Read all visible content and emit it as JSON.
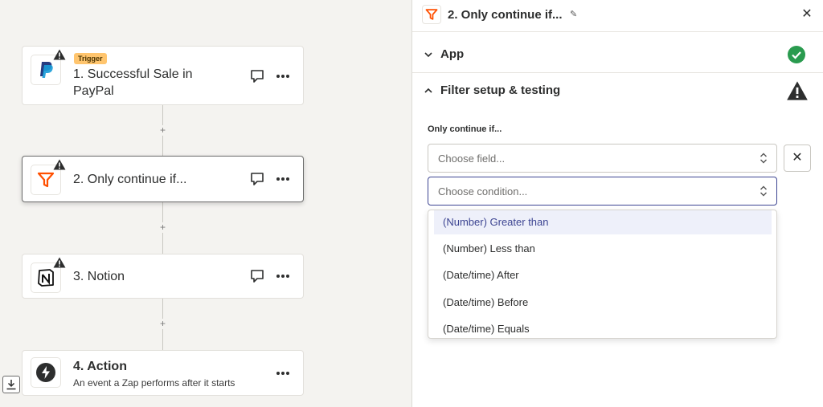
{
  "canvas": {
    "steps": [
      {
        "badge": "Trigger",
        "title_line1": "1. Successful Sale in",
        "title_line2": "PayPal"
      },
      {
        "title": "2. Only continue if..."
      },
      {
        "title": "3. Notion"
      },
      {
        "title": "4. Action",
        "subtitle": "An event a Zap performs after it starts"
      }
    ],
    "plus_label": "+",
    "icons": {
      "paypal": "paypal-icon",
      "filter": "filter-icon",
      "notion": "notion-icon",
      "action": "lightning-icon",
      "warning": "warning-icon",
      "comment": "comment-icon",
      "more": "more-icon",
      "download": "download-icon"
    }
  },
  "panel": {
    "title": "2. Only continue if...",
    "close_label": "✕",
    "sections": [
      {
        "title": "App",
        "status": "complete"
      },
      {
        "title": "Filter setup & testing",
        "status": "warning"
      }
    ],
    "filter": {
      "label": "Only continue if...",
      "field_placeholder": "Choose field...",
      "condition_placeholder": "Choose condition...",
      "remove_label": "✕",
      "options": [
        "(Number) Greater than",
        "(Number) Less than",
        "(Date/time) After",
        "(Date/time) Before",
        "(Date/time) Equals"
      ],
      "active_option_index": 0
    }
  },
  "colors": {
    "accent": "#3d4592",
    "success": "#2a9b4f",
    "trigger_badge": "#ffc56e",
    "filter_orange": "#ff4f00",
    "paypal_dark": "#253b80",
    "paypal_light": "#179bd7"
  }
}
